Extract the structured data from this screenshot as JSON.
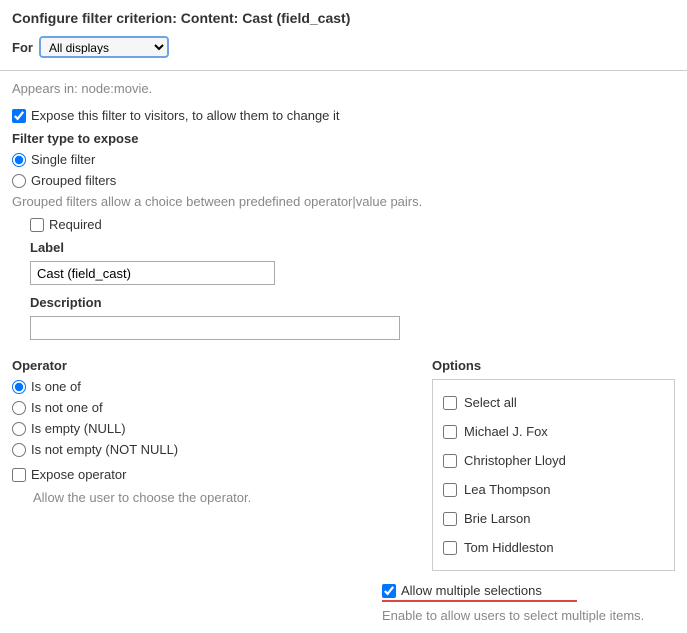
{
  "title": "Configure filter criterion: Content: Cast (field_cast)",
  "for_label": "For",
  "for_select": {
    "selected": "All displays",
    "options": [
      "All displays"
    ]
  },
  "appears_in": "Appears in: node:movie.",
  "expose_filter": {
    "checked": true,
    "label": "Expose this filter to visitors, to allow them to change it"
  },
  "filter_type_label": "Filter type to expose",
  "filter_type": {
    "single": {
      "label": "Single filter",
      "checked": true
    },
    "grouped": {
      "label": "Grouped filters",
      "checked": false
    }
  },
  "grouped_help": "Grouped filters allow a choice between predefined operator|value pairs.",
  "required": {
    "label": "Required",
    "checked": false
  },
  "label_section": {
    "label": "Label",
    "value": "Cast (field_cast)"
  },
  "description_section": {
    "label": "Description",
    "value": ""
  },
  "operator_label": "Operator",
  "operators": [
    {
      "label": "Is one of",
      "checked": true
    },
    {
      "label": "Is not one of",
      "checked": false
    },
    {
      "label": "Is empty (NULL)",
      "checked": false
    },
    {
      "label": "Is not empty (NOT NULL)",
      "checked": false
    }
  ],
  "expose_operator": {
    "label": "Expose operator",
    "checked": false,
    "help": "Allow the user to choose the operator."
  },
  "options_label": "Options",
  "options": [
    {
      "label": "Select all",
      "checked": false
    },
    {
      "label": "Michael J. Fox",
      "checked": false
    },
    {
      "label": "Christopher Lloyd",
      "checked": false
    },
    {
      "label": "Lea Thompson",
      "checked": false
    },
    {
      "label": "Brie Larson",
      "checked": false
    },
    {
      "label": "Tom Hiddleston",
      "checked": false
    }
  ],
  "allow_multiple": {
    "label": "Allow multiple selections",
    "checked": true,
    "help": "Enable to allow users to select multiple items."
  }
}
